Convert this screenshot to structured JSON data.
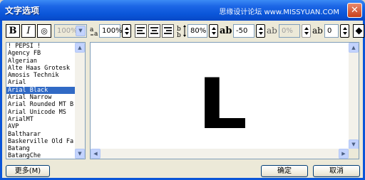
{
  "window": {
    "title": "文字选项",
    "watermark": "思缘设计论坛 www.MISSYUAN.COM",
    "close_glyph": "✕"
  },
  "toolbar": {
    "bold_label": "B",
    "italic_label": "I",
    "outline_label": "◎",
    "size_value": "100%",
    "width_scale_value": "100%",
    "height_scale_value": "80%",
    "spacing_value": "-50",
    "kerning_value": "0%",
    "baseline_value": "0",
    "width_scale_glyph": "⅟ₐ",
    "height_scale_glyph": "ᵇ‡",
    "spacing_glyph": "ab",
    "kerning_glyph": "ab",
    "baseline_glyph": "ab"
  },
  "fonts": {
    "items": [
      "! PEPSI !",
      "Agency FB",
      "Algerian",
      "Alte Haas Grotesk",
      "Amosis Technik",
      "Arial",
      "Arial Black",
      "Arial Narrow",
      "Arial Rounded MT B",
      "Arial Unicode MS",
      "ArialMT",
      "AVP",
      "Baltharar",
      "Baskerville Old Fa",
      "Batang",
      "BatangChe"
    ],
    "selected_index": 6
  },
  "preview": {
    "text": "L"
  },
  "buttons": {
    "more": "更多(M)",
    "ok": "确定",
    "cancel": "取消"
  },
  "scroll": {
    "up": "▲",
    "down": "▼",
    "left": "◀",
    "right": "▶",
    "dropdown": "▼"
  }
}
